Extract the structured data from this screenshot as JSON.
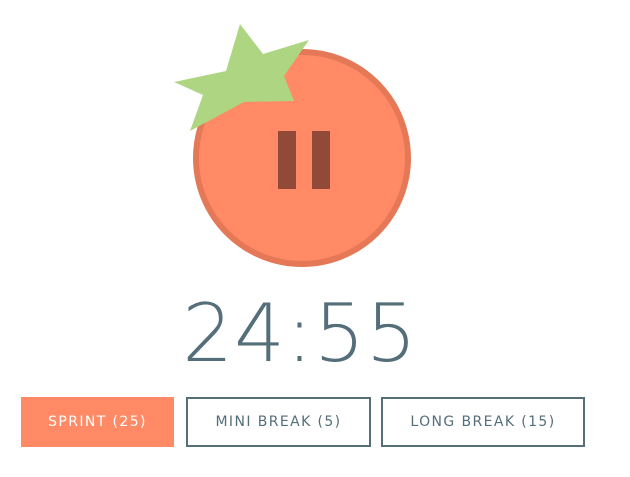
{
  "timer": {
    "display": "24:55"
  },
  "tomato": {
    "state": "running",
    "control_icon": "pause-icon"
  },
  "modes": [
    {
      "label": "SPRINT (25)",
      "active": true
    },
    {
      "label": "MINI BREAK (5)",
      "active": false
    },
    {
      "label": "LONG BREAK (15)",
      "active": false
    }
  ],
  "colors": {
    "tomato": "#ff8a65",
    "tomato_outline": "#e57857",
    "leaf": "#aed581",
    "pause_bars": "#914a37",
    "text": "#546e7a",
    "active_button_bg": "#ff8a65",
    "active_button_text": "#ffffff"
  }
}
